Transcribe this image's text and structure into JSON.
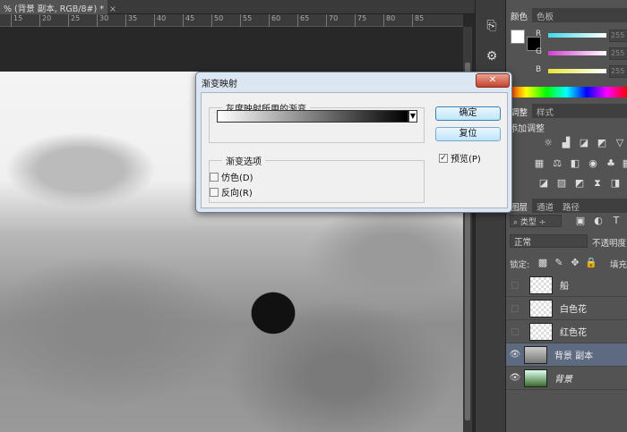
{
  "document": {
    "tab_title": "% (背景 副本, RGB/8#) *",
    "close": "×"
  },
  "ruler": {
    "ticks": [
      "15",
      "20",
      "25",
      "30",
      "35",
      "40",
      "45",
      "50",
      "55",
      "60",
      "65",
      "70",
      "75",
      "80",
      "85"
    ]
  },
  "color_panel": {
    "tabs": [
      "颜色",
      "色板"
    ],
    "channels": [
      {
        "label": "R",
        "value": "255",
        "color": "#3fd9e6"
      },
      {
        "label": "G",
        "value": "255",
        "color": "#d23fd2"
      },
      {
        "label": "B",
        "value": "255",
        "color": "#e6e63a"
      }
    ]
  },
  "adjustments_panel": {
    "tabs": [
      "调整",
      "样式"
    ],
    "heading": "添加调整"
  },
  "layers_panel": {
    "tabs": [
      "图层",
      "通道",
      "路径"
    ],
    "filter_label": "类型",
    "blend_mode": "正常",
    "opacity_label": "不透明度",
    "lock_label": "锁定:",
    "fill_label": "填充",
    "layers": [
      {
        "name": "船",
        "visible": false
      },
      {
        "name": "白色花",
        "visible": false
      },
      {
        "name": "红色花",
        "visible": false
      },
      {
        "name": "背景 副本",
        "visible": true,
        "selected": true
      },
      {
        "name": "背景",
        "visible": true
      }
    ]
  },
  "dialog": {
    "title": "渐变映射",
    "close": "✕",
    "gradient_group": "灰度映射所用的渐变",
    "options_group": "渐变选项",
    "dither": "仿色(D)",
    "reverse": "反向(R)",
    "ok": "确定",
    "reset": "复位",
    "preview": "预览(P)",
    "preview_checked": true,
    "dither_checked": false,
    "reverse_checked": false
  }
}
